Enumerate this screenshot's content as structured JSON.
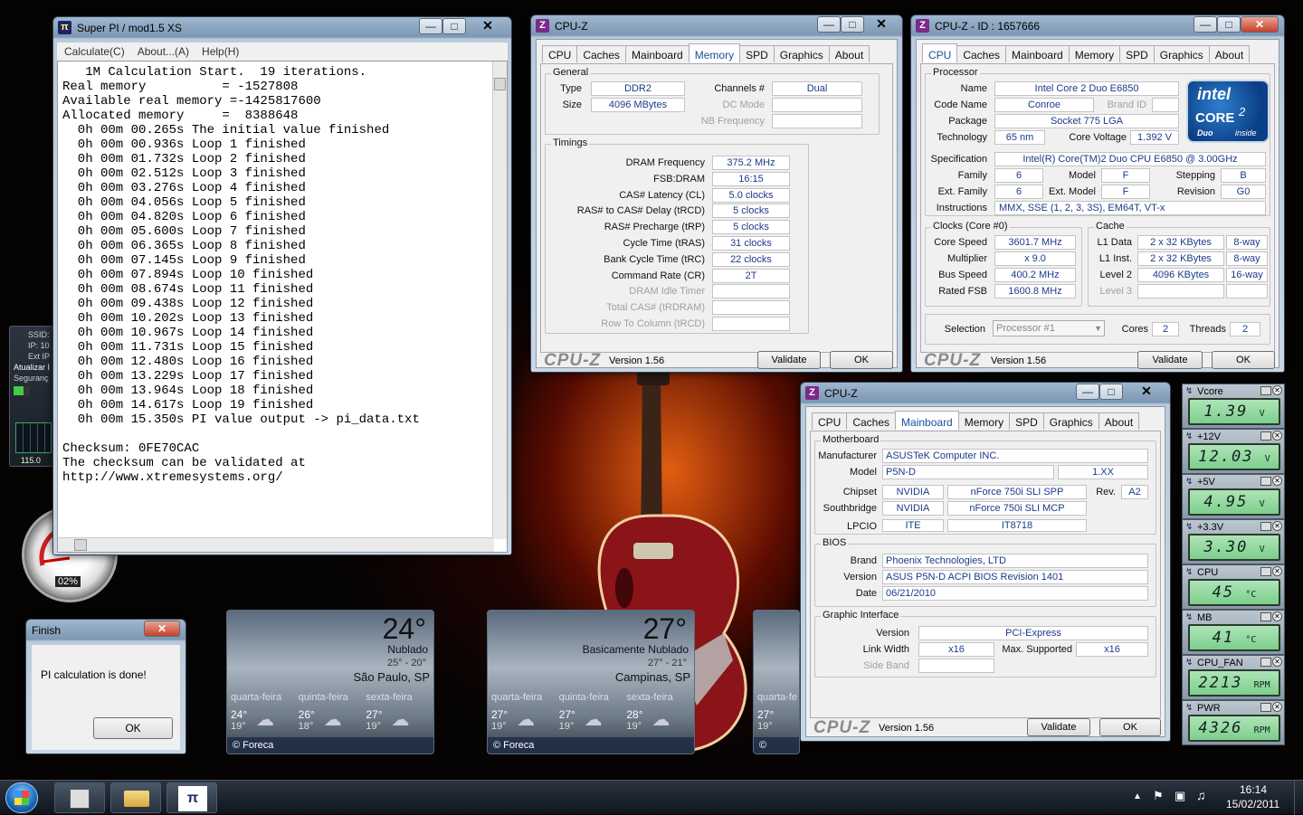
{
  "superpi": {
    "title": "Super PI / mod1.5 XS",
    "menu": [
      "Calculate(C)",
      "About...(A)",
      "Help(H)"
    ],
    "lines": [
      "   1M Calculation Start.  19 iterations.",
      "Real memory          = -1527808",
      "Available real memory =-1425817600",
      "Allocated memory     =  8388648",
      "  0h 00m 00.265s The initial value finished",
      "  0h 00m 00.936s Loop 1 finished",
      "  0h 00m 01.732s Loop 2 finished",
      "  0h 00m 02.512s Loop 3 finished",
      "  0h 00m 03.276s Loop 4 finished",
      "  0h 00m 04.056s Loop 5 finished",
      "  0h 00m 04.820s Loop 6 finished",
      "  0h 00m 05.600s Loop 7 finished",
      "  0h 00m 06.365s Loop 8 finished",
      "  0h 00m 07.145s Loop 9 finished",
      "  0h 00m 07.894s Loop 10 finished",
      "  0h 00m 08.674s Loop 11 finished",
      "  0h 00m 09.438s Loop 12 finished",
      "  0h 00m 10.202s Loop 13 finished",
      "  0h 00m 10.967s Loop 14 finished",
      "  0h 00m 11.731s Loop 15 finished",
      "  0h 00m 12.480s Loop 16 finished",
      "  0h 00m 13.229s Loop 17 finished",
      "  0h 00m 13.964s Loop 18 finished",
      "  0h 00m 14.617s Loop 19 finished",
      "  0h 00m 15.350s PI value output -> pi_data.txt",
      "",
      "Checksum: 0FE70CAC",
      "The checksum can be validated at",
      "http://www.xtremesystems.org/"
    ]
  },
  "finish": {
    "title": "Finish",
    "message": "PI calculation is done!",
    "ok": "OK"
  },
  "tabs": [
    "CPU",
    "Caches",
    "Mainboard",
    "Memory",
    "SPD",
    "Graphics",
    "About"
  ],
  "cpuz_common": {
    "logo": "CPU-Z",
    "version": "Version 1.56",
    "validate": "Validate",
    "ok": "OK"
  },
  "mem": {
    "title": "CPU-Z",
    "general": "General",
    "type_l": "Type",
    "type": "DDR2",
    "size_l": "Size",
    "size": "4096 MBytes",
    "channels_l": "Channels #",
    "channels": "Dual",
    "dcmode_l": "DC Mode",
    "nbfreq_l": "NB Frequency",
    "timings": "Timings",
    "rows": [
      {
        "l": "DRAM Frequency",
        "v": "375.2 MHz"
      },
      {
        "l": "FSB:DRAM",
        "v": "16:15"
      },
      {
        "l": "CAS# Latency (CL)",
        "v": "5.0 clocks"
      },
      {
        "l": "RAS# to CAS# Delay (tRCD)",
        "v": "5 clocks"
      },
      {
        "l": "RAS# Precharge (tRP)",
        "v": "5 clocks"
      },
      {
        "l": "Cycle Time (tRAS)",
        "v": "31 clocks"
      },
      {
        "l": "Bank Cycle Time (tRC)",
        "v": "22 clocks"
      },
      {
        "l": "Command Rate (CR)",
        "v": "2T"
      },
      {
        "l": "DRAM Idle Timer",
        "v": ""
      },
      {
        "l": "Total CAS# (tRDRAM)",
        "v": ""
      },
      {
        "l": "Row To Column (tRCD)",
        "v": ""
      }
    ]
  },
  "cpu": {
    "title": "CPU-Z - ID : 1657666",
    "processor": "Processor",
    "name_l": "Name",
    "name": "Intel Core 2 Duo E6850",
    "code_l": "Code Name",
    "code": "Conroe",
    "brand_l": "Brand ID",
    "pkg_l": "Package",
    "pkg": "Socket 775 LGA",
    "tech_l": "Technology",
    "tech": "65 nm",
    "volt_l": "Core Voltage",
    "volt": "1.392 V",
    "spec_l": "Specification",
    "spec": "Intel(R) Core(TM)2 Duo CPU     E6850  @ 3.00GHz",
    "fam_l": "Family",
    "fam": "6",
    "model_l": "Model",
    "model": "F",
    "step_l": "Stepping",
    "step": "B",
    "efam_l": "Ext. Family",
    "efam": "6",
    "emodel_l": "Ext. Model",
    "emodel": "F",
    "rev_l": "Revision",
    "rev": "G0",
    "instr_l": "Instructions",
    "instr": "MMX, SSE (1, 2, 3, 3S), EM64T, VT-x",
    "clocks": "Clocks (Core #0)",
    "cs_l": "Core Speed",
    "cs": "3601.7 MHz",
    "mult_l": "Multiplier",
    "mult": "x 9.0",
    "bus_l": "Bus Speed",
    "bus": "400.2 MHz",
    "fsb_l": "Rated FSB",
    "fsb": "1600.8 MHz",
    "cache": "Cache",
    "l1d_l": "L1 Data",
    "l1d": "2 x 32 KBytes",
    "l1d_w": "8-way",
    "l1i_l": "L1 Inst.",
    "l1i": "2 x 32 KBytes",
    "l1i_w": "8-way",
    "l2_l": "Level 2",
    "l2": "4096 KBytes",
    "l2_w": "16-way",
    "l3_l": "Level 3",
    "sel_l": "Selection",
    "sel": "Processor #1",
    "cores_l": "Cores",
    "cores": "2",
    "threads_l": "Threads",
    "threads": "2",
    "logo_top": "intel",
    "logo_mid": "CORE",
    "logo_2": "2",
    "logo_duo": "Duo",
    "logo_inside": "inside"
  },
  "mb": {
    "title": "CPU-Z",
    "motherboard": "Motherboard",
    "man_l": "Manufacturer",
    "man": "ASUSTeK Computer INC.",
    "model_l": "Model",
    "model": "P5N-D",
    "model_rev": "1.XX",
    "chip_l": "Chipset",
    "chip_v": "NVIDIA",
    "chip": "nForce 750i SLI SPP",
    "rev_l": "Rev.",
    "rev": "A2",
    "sb_l": "Southbridge",
    "sb_v": "NVIDIA",
    "sb": "nForce 750i SLI MCP",
    "lpc_l": "LPCIO",
    "lpc_v": "ITE",
    "lpc": "IT8718",
    "bios": "BIOS",
    "brand_l": "Brand",
    "brand": "Phoenix Technologies, LTD",
    "ver_l": "Version",
    "ver": "ASUS P5N-D ACPI BIOS Revision 1401",
    "date_l": "Date",
    "date": "06/21/2010",
    "gi": "Graphic Interface",
    "giv_l": "Version",
    "giv": "PCI-Express",
    "lw_l": "Link Width",
    "lw": "x16",
    "ms_l": "Max. Supported",
    "ms": "x16",
    "sb2_l": "Side Band"
  },
  "weather": [
    {
      "temp": "24°",
      "cond": "Nublado",
      "range": "25° - 20°",
      "city": "São Paulo, SP",
      "days": [
        {
          "d": "quarta-feira",
          "hi": "24°",
          "lo": "19°"
        },
        {
          "d": "quinta-feira",
          "hi": "26°",
          "lo": "18°"
        },
        {
          "d": "sexta-feira",
          "hi": "27°",
          "lo": "19°"
        }
      ]
    },
    {
      "temp": "27°",
      "cond": "Basicamente Nublado",
      "range": "27° - 21°",
      "city": "Campinas, SP",
      "days": [
        {
          "d": "quarta-feira",
          "hi": "27°",
          "lo": "19°"
        },
        {
          "d": "quinta-feira",
          "hi": "27°",
          "lo": "19°"
        },
        {
          "d": "sexta-feira",
          "hi": "28°",
          "lo": "19°"
        }
      ]
    }
  ],
  "weather3": {
    "day": "quarta-fe",
    "hi": "27°",
    "lo": "19°"
  },
  "foreca": "© Foreca",
  "hwmon": [
    {
      "l": "Vcore",
      "v": "1.39",
      "u": "V"
    },
    {
      "l": "+12V",
      "v": "12.03",
      "u": "V"
    },
    {
      "l": "+5V",
      "v": "4.95",
      "u": "V"
    },
    {
      "l": "+3.3V",
      "v": "3.30",
      "u": "V"
    },
    {
      "l": "CPU",
      "v": "45",
      "u": "°C"
    },
    {
      "l": "MB",
      "v": "41",
      "u": "°C"
    },
    {
      "l": "CPU_FAN",
      "v": "2213",
      "u": "RPM"
    },
    {
      "l": "PWR",
      "v": "4326",
      "u": "RPM"
    }
  ],
  "network": {
    "ssid": "SSID:",
    "ip": "IP: 10",
    "extip": "Ext IP",
    "update": "Atualizar I",
    "security": "Seguranç",
    "rate": "115.0"
  },
  "gauge": {
    "pct": "02%"
  },
  "clock": {
    "time": "16:14",
    "date": "15/02/2011"
  }
}
